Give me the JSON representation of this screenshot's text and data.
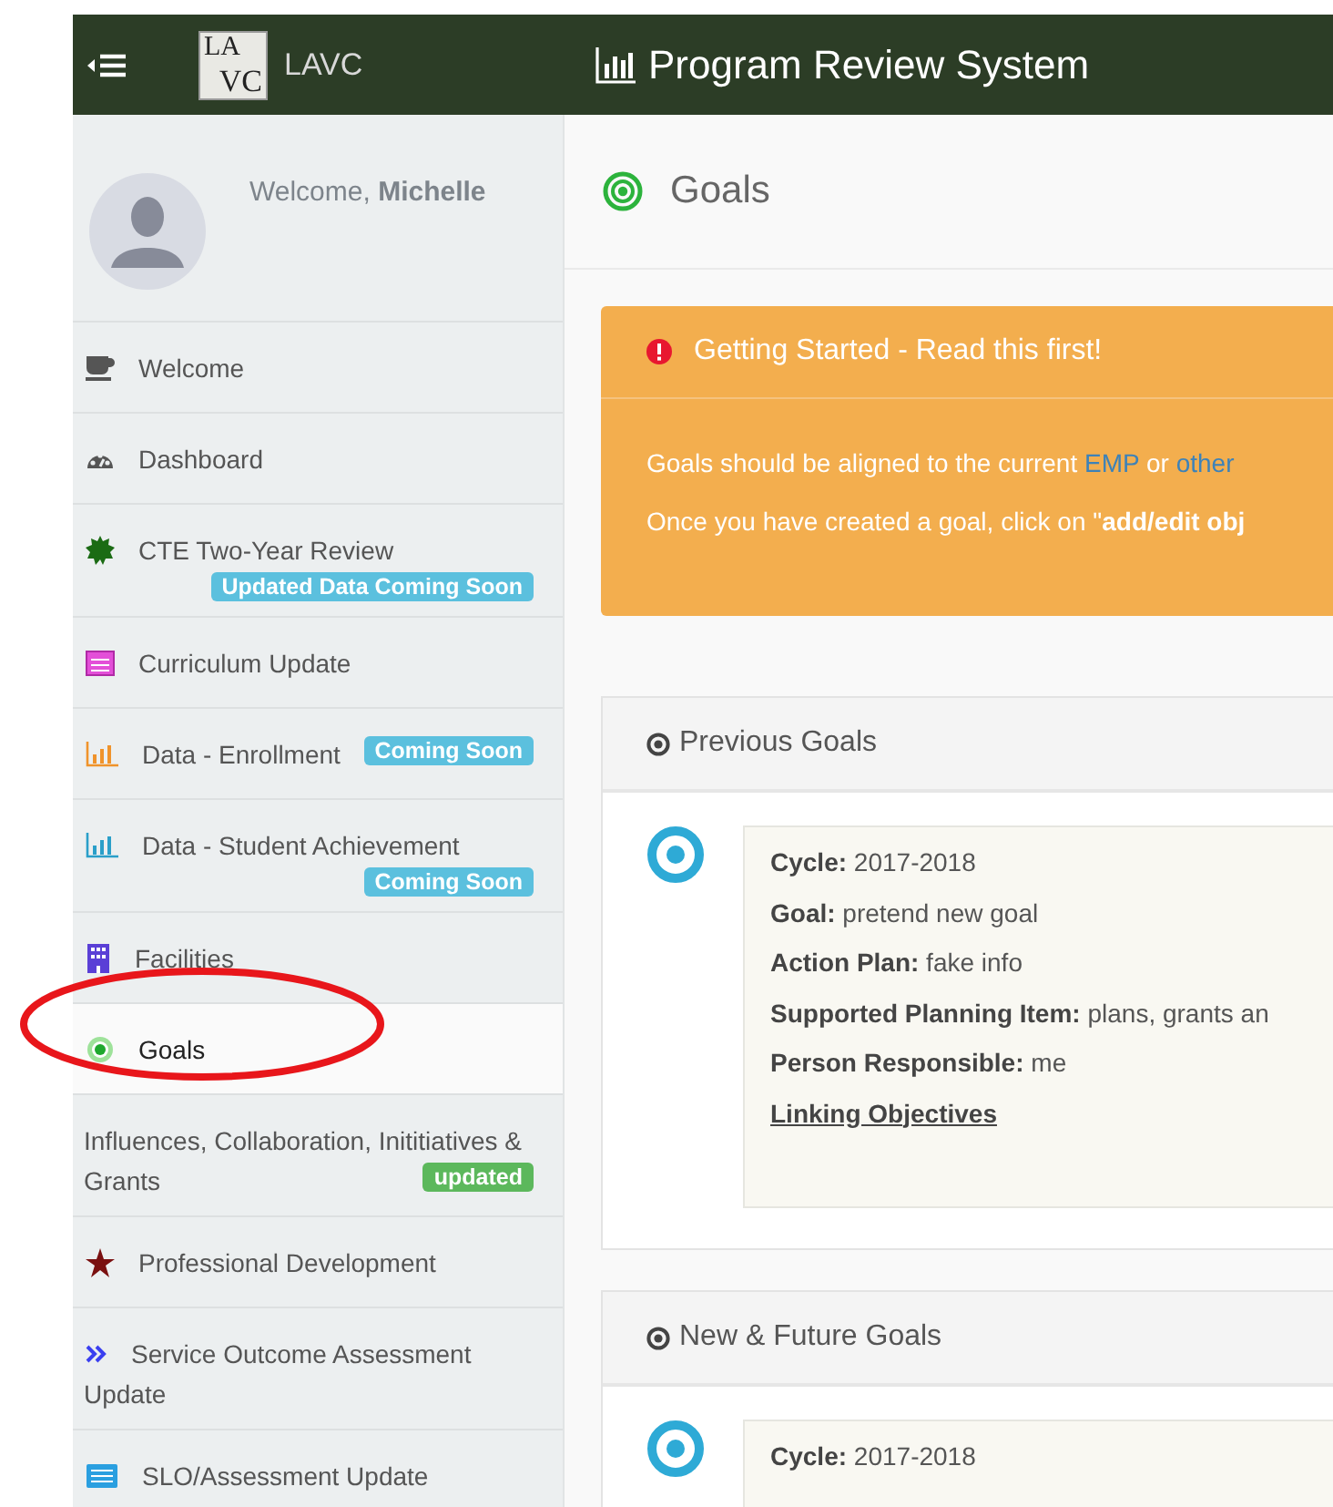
{
  "header": {
    "logo_top": "LA",
    "logo_bottom": "VC",
    "brand": "LAVC",
    "title": "Program Review System"
  },
  "sidebar": {
    "welcome": "Welcome, **Michelle**",
    "items": [
      {
        "label": "Welcome",
        "selected": false
      },
      {
        "label": "Dashboard",
        "selected": false
      },
      {
        "label": "CTE Two-Year Review",
        "selected": false,
        "badge": {
          "text": "Updated Data Coming Soon",
          "color": "#5bc0de"
        }
      },
      {
        "label": "Curriculum Update",
        "selected": false
      },
      {
        "label": "Data - Enrollment",
        "selected": false,
        "badge": {
          "text": "Coming Soon",
          "color": "#5bc0de"
        }
      },
      {
        "label": "Data - Student Achievement",
        "selected": false,
        "badge": {
          "text": "Coming Soon",
          "color": "#5bc0de"
        }
      },
      {
        "label": "Facilities",
        "selected": false
      },
      {
        "label": "Goals",
        "selected": true
      },
      {
        "label": "Influences, Collaboration, Inititiatives & Grants",
        "selected": false,
        "badge": {
          "text": "updated",
          "color": "#5cb85c"
        }
      },
      {
        "label": "Professional Development",
        "selected": false
      },
      {
        "label": "Service Outcome Assessment Update",
        "selected": false
      },
      {
        "label": "SLO/Assessment Update",
        "selected": false
      }
    ]
  },
  "page_title": "Goals",
  "alert": {
    "title": "Getting Started - Read this first!",
    "lines": [
      [
        {
          "text": "Goals should be aligned to the current "
        },
        {
          "text": "EMP",
          "link": true
        },
        {
          "text": " or "
        },
        {
          "text": "other",
          "link": true
        }
      ],
      [
        {
          "text": "Once you have created a goal, click on \"**add/edit obj**"
        }
      ]
    ]
  },
  "sections": [
    {
      "title": "Previous Goals",
      "goals": [
        {
          "fields": [
            "**Cycle:** 2017-2018",
            "**Goal:** pretend new goal",
            "**Action Plan:** fake info",
            "**Supported Planning Item:** plans, grants an",
            "**Person Responsible:** me"
          ],
          "link": "Linking Objectives"
        }
      ]
    },
    {
      "title": "New & Future Goals",
      "goals": [
        {
          "fields": [
            "**Cycle:** 2017-2018"
          ]
        }
      ]
    }
  ]
}
